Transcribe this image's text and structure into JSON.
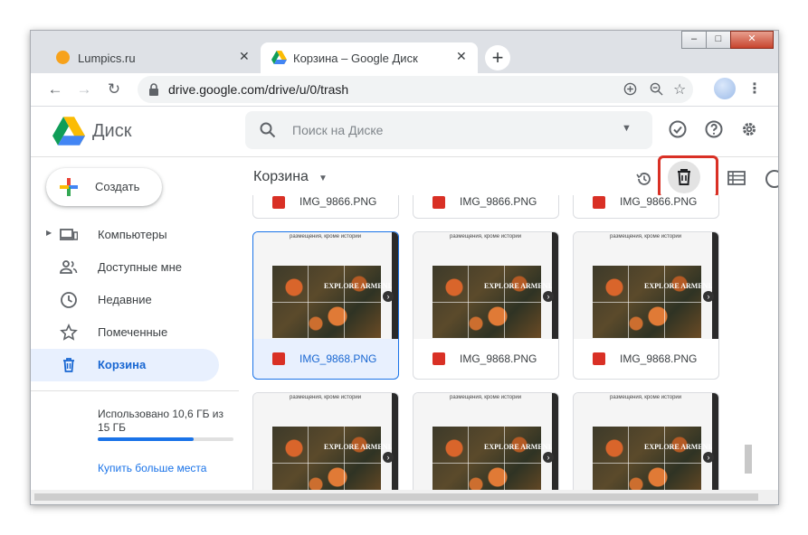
{
  "browser": {
    "tabs": [
      {
        "title": "Lumpics.ru",
        "close": "✕"
      },
      {
        "title": "Корзина – Google Диск",
        "close": "✕"
      }
    ],
    "new_tab": "+",
    "window_buttons": {
      "minimize": "–",
      "maximize": "□",
      "close": "✕"
    },
    "url": "drive.google.com/drive/u/0/trash"
  },
  "drive": {
    "app_name": "Диск",
    "search_placeholder": "Поиск на Диске",
    "create_label": "Создать",
    "breadcrumb": "Корзина",
    "sidebar": [
      {
        "label": "Компьютеры",
        "icon": "computer-icon"
      },
      {
        "label": "Доступные мне",
        "icon": "people-icon"
      },
      {
        "label": "Недавние",
        "icon": "clock-icon"
      },
      {
        "label": "Помеченные",
        "icon": "star-icon"
      },
      {
        "label": "Корзина",
        "icon": "trash-icon"
      }
    ],
    "storage": {
      "text": "Использовано 10,6 ГБ из 15 ГБ",
      "used_fraction": 0.707,
      "buy": "Купить больше места"
    },
    "files_top": [
      "IMG_9866.PNG",
      "IMG_9866.PNG",
      "IMG_9866.PNG"
    ],
    "files_mid": [
      "IMG_9868.PNG",
      "IMG_9868.PNG",
      "IMG_9868.PNG"
    ],
    "thumb_caption": "размещения, кроме истории",
    "thumb_title": "EXPLORE ARMENIA",
    "colors": {
      "accent": "#1a73e8",
      "highlight": "#d93025",
      "active_bg": "#e8f0fe"
    }
  }
}
